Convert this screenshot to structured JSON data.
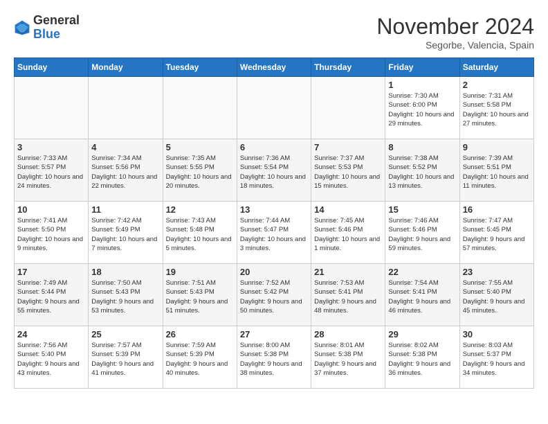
{
  "header": {
    "logo_general": "General",
    "logo_blue": "Blue",
    "month_title": "November 2024",
    "location": "Segorbe, Valencia, Spain"
  },
  "weekdays": [
    "Sunday",
    "Monday",
    "Tuesday",
    "Wednesday",
    "Thursday",
    "Friday",
    "Saturday"
  ],
  "weeks": [
    [
      {
        "day": "",
        "info": ""
      },
      {
        "day": "",
        "info": ""
      },
      {
        "day": "",
        "info": ""
      },
      {
        "day": "",
        "info": ""
      },
      {
        "day": "",
        "info": ""
      },
      {
        "day": "1",
        "info": "Sunrise: 7:30 AM\nSunset: 6:00 PM\nDaylight: 10 hours and 29 minutes."
      },
      {
        "day": "2",
        "info": "Sunrise: 7:31 AM\nSunset: 5:58 PM\nDaylight: 10 hours and 27 minutes."
      }
    ],
    [
      {
        "day": "3",
        "info": "Sunrise: 7:33 AM\nSunset: 5:57 PM\nDaylight: 10 hours and 24 minutes."
      },
      {
        "day": "4",
        "info": "Sunrise: 7:34 AM\nSunset: 5:56 PM\nDaylight: 10 hours and 22 minutes."
      },
      {
        "day": "5",
        "info": "Sunrise: 7:35 AM\nSunset: 5:55 PM\nDaylight: 10 hours and 20 minutes."
      },
      {
        "day": "6",
        "info": "Sunrise: 7:36 AM\nSunset: 5:54 PM\nDaylight: 10 hours and 18 minutes."
      },
      {
        "day": "7",
        "info": "Sunrise: 7:37 AM\nSunset: 5:53 PM\nDaylight: 10 hours and 15 minutes."
      },
      {
        "day": "8",
        "info": "Sunrise: 7:38 AM\nSunset: 5:52 PM\nDaylight: 10 hours and 13 minutes."
      },
      {
        "day": "9",
        "info": "Sunrise: 7:39 AM\nSunset: 5:51 PM\nDaylight: 10 hours and 11 minutes."
      }
    ],
    [
      {
        "day": "10",
        "info": "Sunrise: 7:41 AM\nSunset: 5:50 PM\nDaylight: 10 hours and 9 minutes."
      },
      {
        "day": "11",
        "info": "Sunrise: 7:42 AM\nSunset: 5:49 PM\nDaylight: 10 hours and 7 minutes."
      },
      {
        "day": "12",
        "info": "Sunrise: 7:43 AM\nSunset: 5:48 PM\nDaylight: 10 hours and 5 minutes."
      },
      {
        "day": "13",
        "info": "Sunrise: 7:44 AM\nSunset: 5:47 PM\nDaylight: 10 hours and 3 minutes."
      },
      {
        "day": "14",
        "info": "Sunrise: 7:45 AM\nSunset: 5:46 PM\nDaylight: 10 hours and 1 minute."
      },
      {
        "day": "15",
        "info": "Sunrise: 7:46 AM\nSunset: 5:46 PM\nDaylight: 9 hours and 59 minutes."
      },
      {
        "day": "16",
        "info": "Sunrise: 7:47 AM\nSunset: 5:45 PM\nDaylight: 9 hours and 57 minutes."
      }
    ],
    [
      {
        "day": "17",
        "info": "Sunrise: 7:49 AM\nSunset: 5:44 PM\nDaylight: 9 hours and 55 minutes."
      },
      {
        "day": "18",
        "info": "Sunrise: 7:50 AM\nSunset: 5:43 PM\nDaylight: 9 hours and 53 minutes."
      },
      {
        "day": "19",
        "info": "Sunrise: 7:51 AM\nSunset: 5:43 PM\nDaylight: 9 hours and 51 minutes."
      },
      {
        "day": "20",
        "info": "Sunrise: 7:52 AM\nSunset: 5:42 PM\nDaylight: 9 hours and 50 minutes."
      },
      {
        "day": "21",
        "info": "Sunrise: 7:53 AM\nSunset: 5:41 PM\nDaylight: 9 hours and 48 minutes."
      },
      {
        "day": "22",
        "info": "Sunrise: 7:54 AM\nSunset: 5:41 PM\nDaylight: 9 hours and 46 minutes."
      },
      {
        "day": "23",
        "info": "Sunrise: 7:55 AM\nSunset: 5:40 PM\nDaylight: 9 hours and 45 minutes."
      }
    ],
    [
      {
        "day": "24",
        "info": "Sunrise: 7:56 AM\nSunset: 5:40 PM\nDaylight: 9 hours and 43 minutes."
      },
      {
        "day": "25",
        "info": "Sunrise: 7:57 AM\nSunset: 5:39 PM\nDaylight: 9 hours and 41 minutes."
      },
      {
        "day": "26",
        "info": "Sunrise: 7:59 AM\nSunset: 5:39 PM\nDaylight: 9 hours and 40 minutes."
      },
      {
        "day": "27",
        "info": "Sunrise: 8:00 AM\nSunset: 5:38 PM\nDaylight: 9 hours and 38 minutes."
      },
      {
        "day": "28",
        "info": "Sunrise: 8:01 AM\nSunset: 5:38 PM\nDaylight: 9 hours and 37 minutes."
      },
      {
        "day": "29",
        "info": "Sunrise: 8:02 AM\nSunset: 5:38 PM\nDaylight: 9 hours and 36 minutes."
      },
      {
        "day": "30",
        "info": "Sunrise: 8:03 AM\nSunset: 5:37 PM\nDaylight: 9 hours and 34 minutes."
      }
    ]
  ]
}
